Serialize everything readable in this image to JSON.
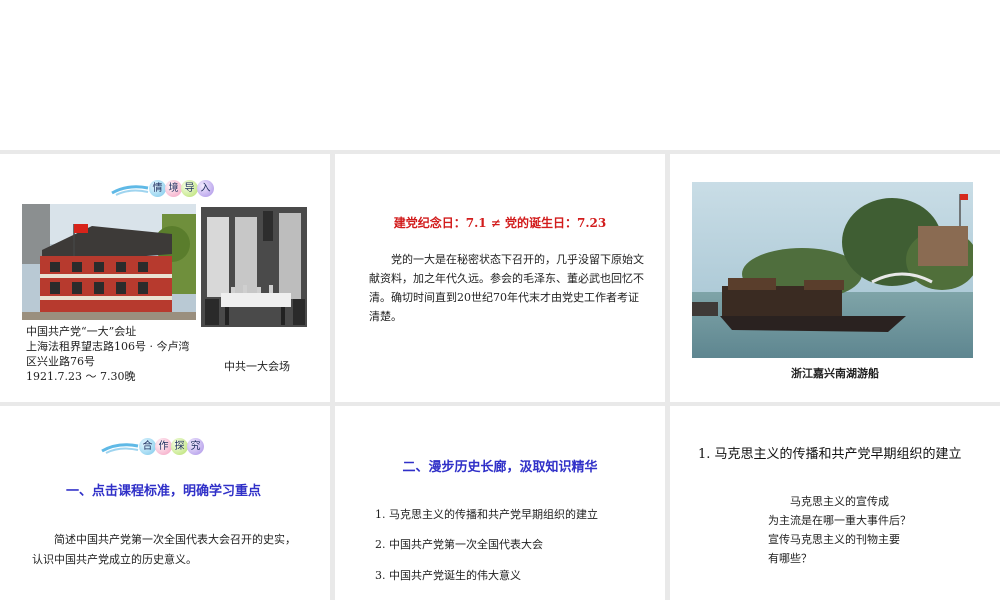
{
  "slide1": {
    "banner": [
      "情",
      "境",
      "导",
      "入"
    ],
    "caption_left": [
      "中国共产党“一大”会址",
      "上海法租界望志路106号 · 今卢湾",
      "区兴业路76号",
      "1921.7.23 ～ 7.30晚"
    ],
    "caption_right": "中共一大会场"
  },
  "slide2": {
    "title": "建党纪念日：7.1 ≠ 党的诞生日：7.23",
    "paragraph": [
      "党的一大是在秘密状态下召开的，几乎没留下原始文",
      "献资料，加之年代久远。参会的毛泽东、董必武也回忆不",
      "清。确切时间直到20世纪70年代末才由党史工作者考证",
      "清楚。"
    ]
  },
  "slide3": {
    "caption": "浙江嘉兴南湖游船"
  },
  "slide4": {
    "banner": [
      "合",
      "作",
      "探",
      "究"
    ],
    "heading": "一、点击课程标准，明确学习重点",
    "body": [
      "简述中国共产党第一次全国代表大会召开的史实，",
      "认识中国共产党成立的历史意义。"
    ]
  },
  "slide5": {
    "heading": "二、漫步历史长廊，汲取知识精华",
    "items": [
      "1. 马克思主义的传播和共产党早期组织的建立",
      "2. 中国共产党第一次全国代表大会",
      "3. 中国共产党诞生的伟大意义"
    ]
  },
  "slide6": {
    "heading": "1. 马克思主义的传播和共产党早期组织的建立",
    "questions": [
      "马克思主义的宣传成",
      "为主流是在哪一重大事件后？",
      "宣传马克思主义的刊物主要",
      "有哪些？"
    ]
  },
  "colors": {
    "red_title": "#d21c1c",
    "blue_title": "#3030c8",
    "caption_brown": "#6b3a12",
    "bg_gap": "#e9e9e9"
  }
}
